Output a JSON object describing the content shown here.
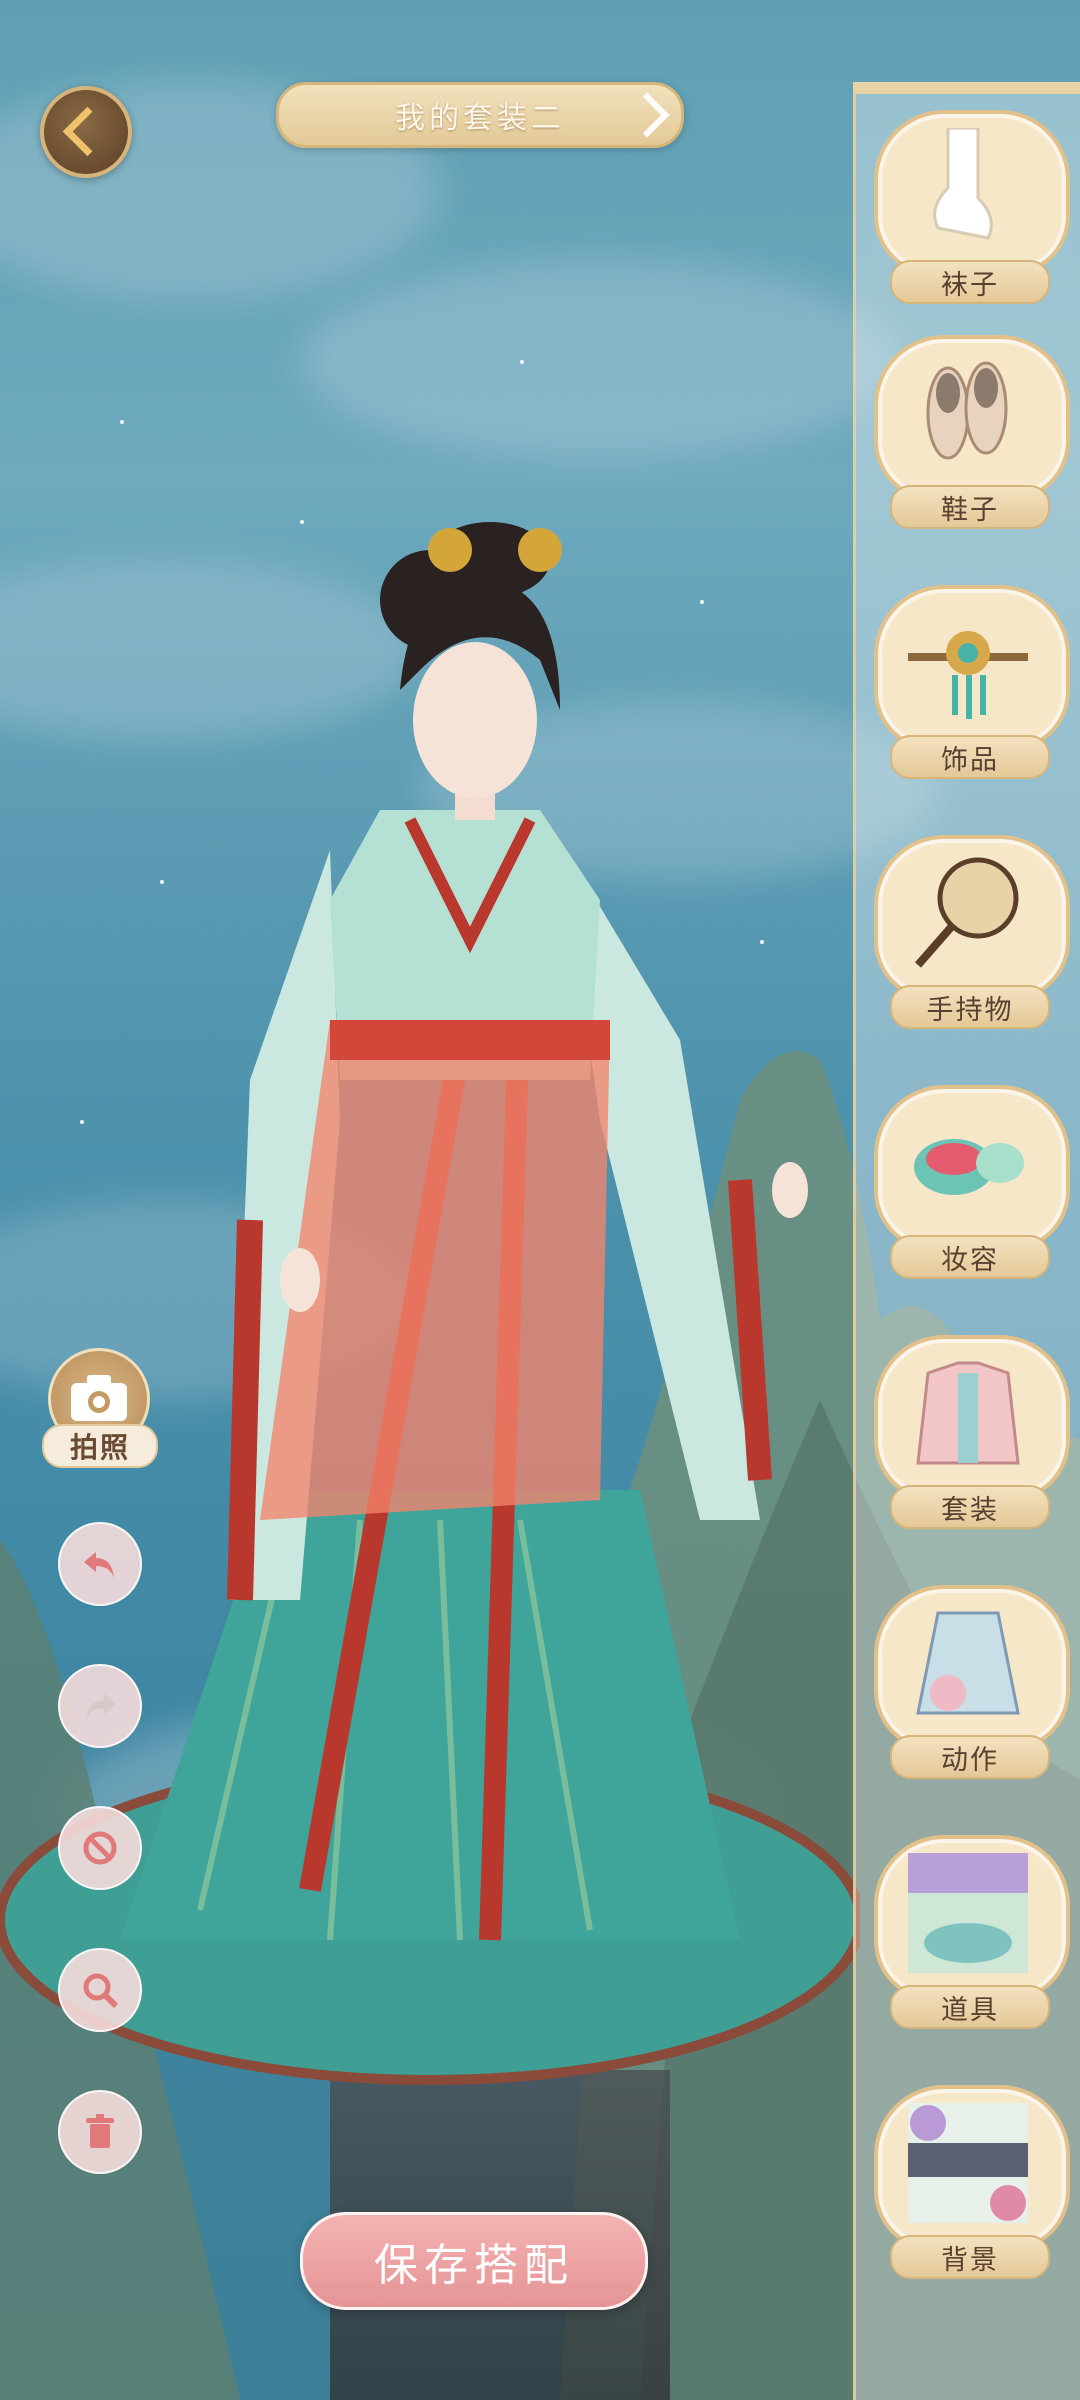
{
  "header": {
    "outfit_title": "我的套装二"
  },
  "categories": [
    {
      "label": "袜子",
      "icon": "socks-icon"
    },
    {
      "label": "鞋子",
      "icon": "shoes-icon"
    },
    {
      "label": "饰品",
      "icon": "hairpin-icon"
    },
    {
      "label": "手持物",
      "icon": "fan-icon"
    },
    {
      "label": "妆容",
      "icon": "makeup-icon"
    },
    {
      "label": "套装",
      "icon": "outfit-icon"
    },
    {
      "label": "动作",
      "icon": "pose-icon"
    },
    {
      "label": "道具",
      "icon": "prop-icon"
    },
    {
      "label": "背景",
      "icon": "background-icon"
    }
  ],
  "tools": {
    "camera_label": "拍照",
    "undo_icon": "undo-icon",
    "redo_icon": "redo-icon",
    "clear_icon": "ban-icon",
    "zoom_icon": "zoom-icon",
    "delete_icon": "trash-icon"
  },
  "footer": {
    "save_label": "保存搭配"
  },
  "colors": {
    "accent_gold": "#d6b57a",
    "save_pink": "#e59495",
    "tool_icon": "#e07a7a"
  }
}
